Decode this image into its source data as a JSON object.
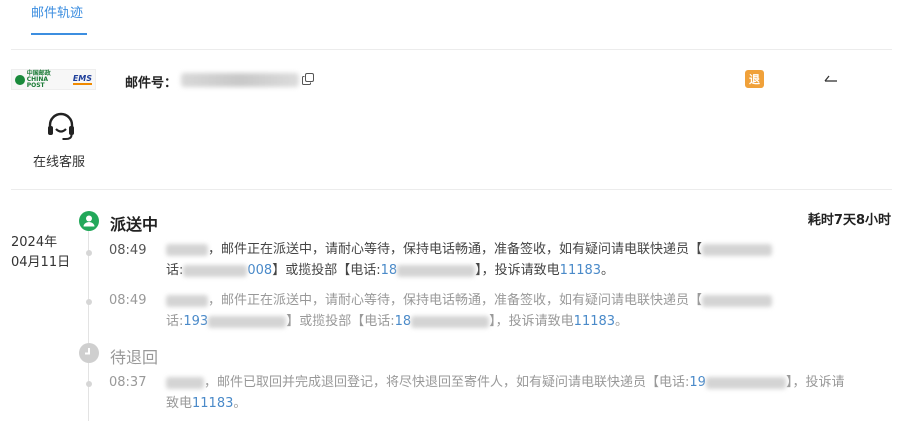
{
  "tabs": {
    "active_label": "邮件轨迹"
  },
  "header": {
    "mail_label": "邮件号：",
    "mail_number": "",
    "return_badge": "退",
    "service_label": "在线客服"
  },
  "timeline": {
    "duration": "耗时7天8小时",
    "date_year": "2024年",
    "date_day": "04月11日",
    "groups": [
      {
        "status": "派送中",
        "events": [
          {
            "time": "08:49",
            "text_a": "，邮件正在派送中，请耐心等待，保持电话畅通，准备签收，如有疑问请电联快递员【",
            "text_b": "话:",
            "phone_a_tail": "008",
            "text_c": "】或揽投部【电话:",
            "phone_b_head": "18",
            "text_d": "】，投诉请致电",
            "hotline": "11183",
            "end": "。"
          },
          {
            "time": "08:49",
            "text_a": "，邮件正在派送中，请耐心等待，保持电话畅通，准备签收，如有疑问请电联快递员【",
            "text_b": "话:",
            "phone_a_head": "193",
            "text_c": "】或揽投部【电话:",
            "phone_b_head": "18",
            "text_d": "】，投诉请致电",
            "hotline": "11183",
            "end": "。"
          }
        ]
      },
      {
        "status": "待退回",
        "events": [
          {
            "time": "08:37",
            "text_a": "，邮件已取回并完成退回登记，将尽快退回至寄件人，如有疑问请电联快递员【电话:",
            "phone_head": "19",
            "text_b": "】，投诉请",
            "text_c": "致电",
            "hotline": "11183",
            "end": "。"
          }
        ]
      }
    ]
  },
  "colors": {
    "accent": "#3c8ee0",
    "status_active": "#22a85a",
    "badge": "#f0a13a",
    "phone": "#4a8ac9"
  },
  "icons": [
    "copy-icon",
    "back-arrow-icon",
    "headset-icon",
    "check-person-icon",
    "clock-icon"
  ]
}
